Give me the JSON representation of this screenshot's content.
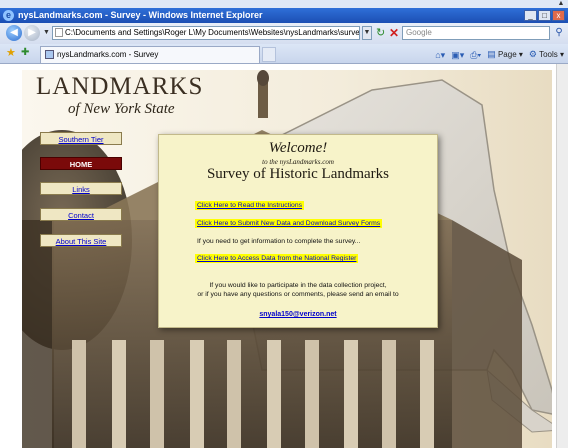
{
  "window": {
    "title": "nysLandmarks.com - Survey - Windows Internet Explorer",
    "buttons": {
      "minimize": "_",
      "maximize": "□",
      "close": "x"
    }
  },
  "address_bar": {
    "url": "C:\\Documents and Settings\\Roger L\\My Documents\\Websites\\nysLandmarks\\survey.htm"
  },
  "search": {
    "placeholder": "Google"
  },
  "tab": {
    "label": "nysLandmarks.com - Survey"
  },
  "command_bar": {
    "page_label": "Page",
    "tools_label": "Tools"
  },
  "site": {
    "title": "LANDMARKS",
    "subtitle": "of New York State"
  },
  "nav": [
    {
      "label": "Southern Tier"
    },
    {
      "label": "HOME"
    },
    {
      "label": "Links"
    },
    {
      "label": "Contact"
    },
    {
      "label": "About This Site"
    }
  ],
  "welcome": {
    "heading": "Welcome!",
    "to_line": "to the nysLandmarks.com",
    "survey_title": "Survey of Historic Landmarks",
    "links": [
      "Click Here to Read the Instructions",
      "Click Here to Submit New Data and Download Survey Forms",
      "Click Here to Access Data from the National Register"
    ],
    "info_line": "If you need to get information to complete the survey...",
    "participate_line1": "If you would like to participate in the data collection project,",
    "participate_line2": "or if you have any questions or comments, please send an email to",
    "email": "snyala150@verizon.net"
  }
}
